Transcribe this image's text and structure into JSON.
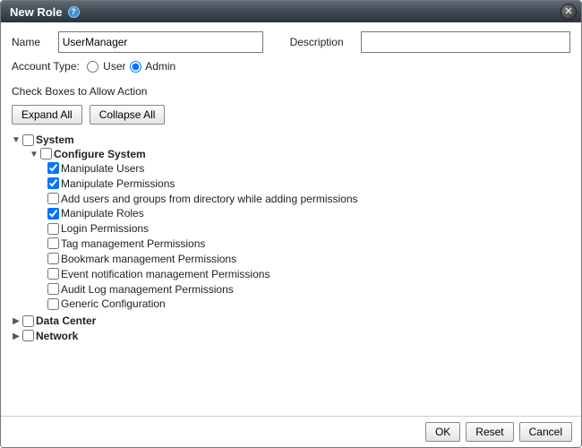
{
  "dialog": {
    "title": "New Role",
    "help_glyph": "?",
    "close_glyph": "✕"
  },
  "form": {
    "name_label": "Name",
    "name_value": "UserManager",
    "description_label": "Description",
    "description_value": "",
    "account_type_label": "Account Type:",
    "account_type_options": {
      "user": "User",
      "admin": "Admin"
    },
    "account_type_selected": "admin"
  },
  "permissions": {
    "section_label": "Check Boxes to Allow Action",
    "expand_all_label": "Expand All",
    "collapse_all_label": "Collapse All"
  },
  "tree": [
    {
      "label": "System",
      "expanded": true,
      "checked": false,
      "bold": true,
      "children": [
        {
          "label": "Configure System",
          "expanded": true,
          "checked": false,
          "bold": true,
          "children": [
            {
              "label": "Manipulate Users",
              "checked": true
            },
            {
              "label": "Manipulate Permissions",
              "checked": true
            },
            {
              "label": "Add users and groups from directory while adding permissions",
              "checked": false
            },
            {
              "label": "Manipulate Roles",
              "checked": true
            },
            {
              "label": "Login Permissions",
              "checked": false
            },
            {
              "label": "Tag management Permissions",
              "checked": false
            },
            {
              "label": "Bookmark management Permissions",
              "checked": false
            },
            {
              "label": "Event notification management Permissions",
              "checked": false
            },
            {
              "label": "Audit Log management Permissions",
              "checked": false
            },
            {
              "label": "Generic Configuration",
              "checked": false
            }
          ]
        }
      ]
    },
    {
      "label": "Data Center",
      "expanded": false,
      "checked": false,
      "bold": true
    },
    {
      "label": "Network",
      "expanded": false,
      "checked": false,
      "bold": true
    }
  ],
  "footer": {
    "ok_label": "OK",
    "reset_label": "Reset",
    "cancel_label": "Cancel"
  }
}
